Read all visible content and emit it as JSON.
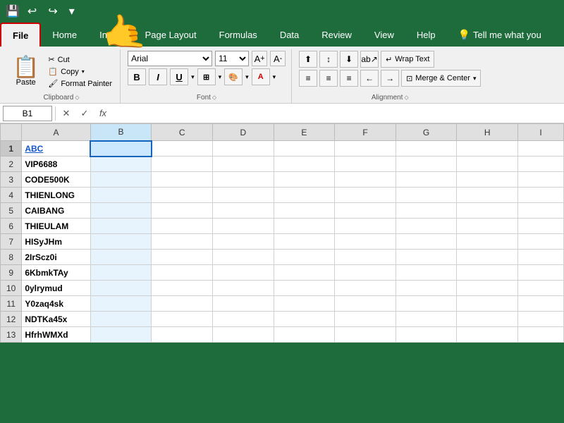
{
  "titlebar": {
    "save_icon": "💾",
    "undo_icon": "↩",
    "redo_icon": "↪",
    "customize_icon": "▾"
  },
  "tabs": [
    {
      "id": "file",
      "label": "File",
      "active": true
    },
    {
      "id": "home",
      "label": "Home",
      "active": false
    },
    {
      "id": "insert",
      "label": "Insert",
      "active": false
    },
    {
      "id": "page_layout",
      "label": "Page Layout",
      "active": false
    },
    {
      "id": "formulas",
      "label": "Formulas",
      "active": false
    },
    {
      "id": "data",
      "label": "Data",
      "active": false
    },
    {
      "id": "review",
      "label": "Review",
      "active": false
    },
    {
      "id": "view",
      "label": "View",
      "active": false
    },
    {
      "id": "help",
      "label": "Help",
      "active": false
    },
    {
      "id": "search",
      "label": "Tell me what you",
      "active": false
    }
  ],
  "clipboard": {
    "paste_label": "Paste",
    "cut_label": "✂ Cut",
    "copy_label": "📋 Copy",
    "format_painter_label": "Format Painter",
    "group_label": "Clipboard"
  },
  "font": {
    "name": "Arial",
    "size": "11",
    "group_label": "Font"
  },
  "alignment": {
    "wrap_text_label": "Wrap Text",
    "merge_center_label": "Merge & Center",
    "group_label": "Alignment"
  },
  "formula_bar": {
    "cell_ref": "B1",
    "formula_content": ""
  },
  "spreadsheet": {
    "columns": [
      "",
      "A",
      "B",
      "C",
      "D",
      "E",
      "F",
      "G",
      "H",
      "I"
    ],
    "rows": [
      {
        "num": 1,
        "cells": [
          "ABC",
          "",
          "",
          "",
          "",
          "",
          "",
          "",
          ""
        ]
      },
      {
        "num": 2,
        "cells": [
          "VIP6688",
          "",
          "",
          "",
          "",
          "",
          "",
          "",
          ""
        ]
      },
      {
        "num": 3,
        "cells": [
          "CODE500K",
          "",
          "",
          "",
          "",
          "",
          "",
          "",
          ""
        ]
      },
      {
        "num": 4,
        "cells": [
          "THIENLONG",
          "",
          "",
          "",
          "",
          "",
          "",
          "",
          ""
        ]
      },
      {
        "num": 5,
        "cells": [
          "CAIBANG",
          "",
          "",
          "",
          "",
          "",
          "",
          "",
          ""
        ]
      },
      {
        "num": 6,
        "cells": [
          "THIEULAM",
          "",
          "",
          "",
          "",
          "",
          "",
          "",
          ""
        ]
      },
      {
        "num": 7,
        "cells": [
          "HISyJHm",
          "",
          "",
          "",
          "",
          "",
          "",
          "",
          ""
        ]
      },
      {
        "num": 8,
        "cells": [
          "2IrScz0i",
          "",
          "",
          "",
          "",
          "",
          "",
          "",
          ""
        ]
      },
      {
        "num": 9,
        "cells": [
          "6KbmkTAy",
          "",
          "",
          "",
          "",
          "",
          "",
          "",
          ""
        ]
      },
      {
        "num": 10,
        "cells": [
          "0ylrymud",
          "",
          "",
          "",
          "",
          "",
          "",
          "",
          ""
        ]
      },
      {
        "num": 11,
        "cells": [
          "Y0zaq4sk",
          "",
          "",
          "",
          "",
          "",
          "",
          "",
          ""
        ]
      },
      {
        "num": 12,
        "cells": [
          "NDTKa45x",
          "",
          "",
          "",
          "",
          "",
          "",
          "",
          ""
        ]
      },
      {
        "num": 13,
        "cells": [
          "HfrhWMXd",
          "",
          "",
          "",
          "",
          "",
          "",
          "",
          ""
        ]
      }
    ],
    "selected_cell": "B1",
    "selected_col": 2,
    "selected_row": 1
  }
}
